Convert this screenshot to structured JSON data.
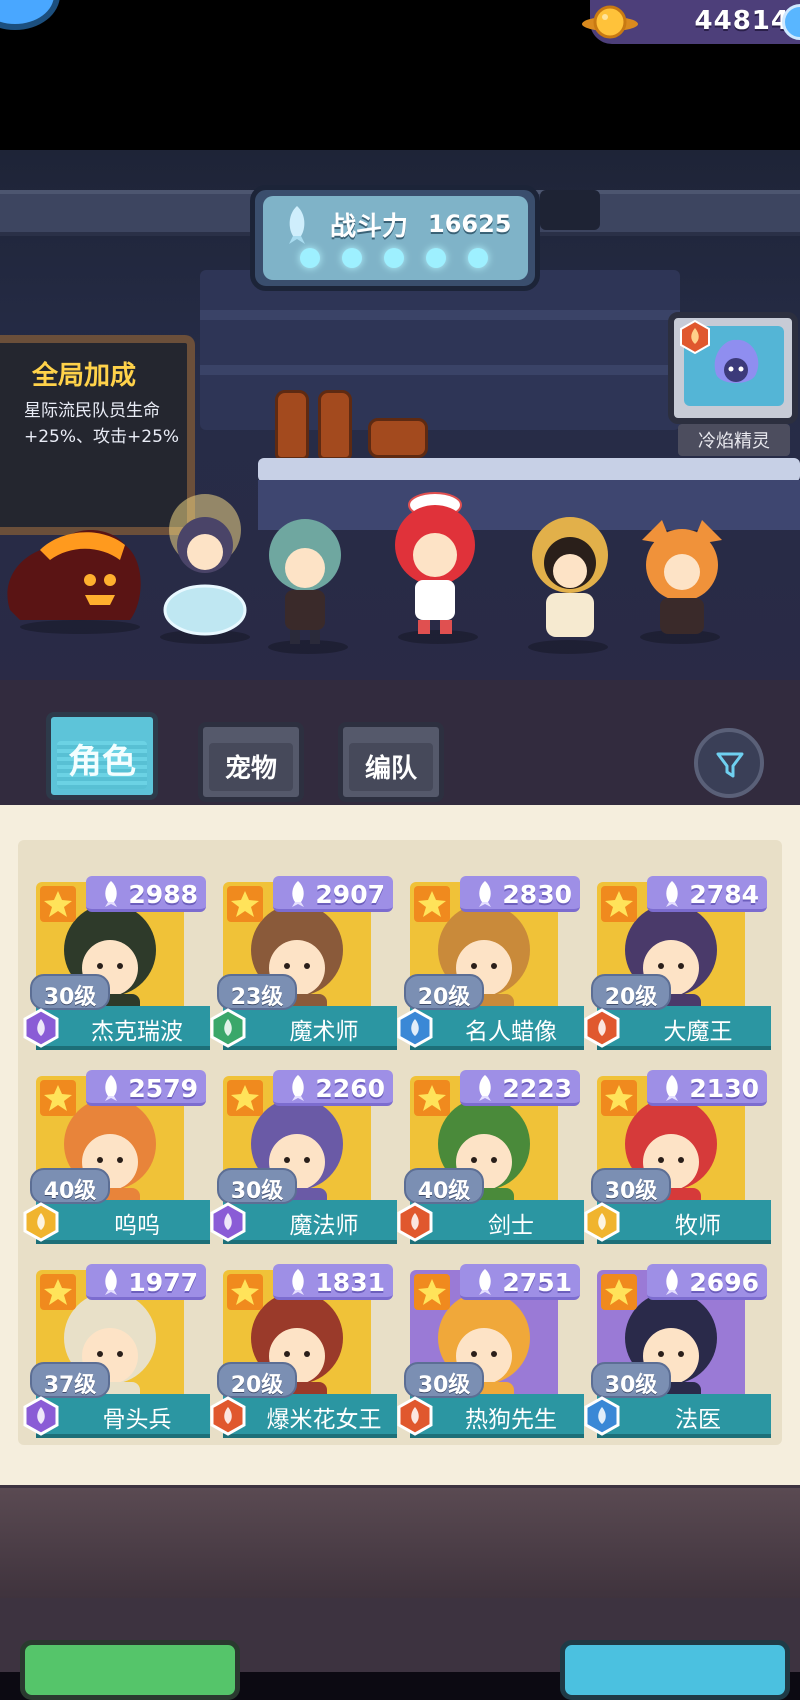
{
  "hud": {
    "currency_icon": "planet-coin-icon",
    "currency_value": "44814"
  },
  "power": {
    "label": "战斗力",
    "value": "16625",
    "dots": 5
  },
  "bonus_board": {
    "title": "全局加成",
    "text": "星际流民队员生命+25%、攻击+25%"
  },
  "tv": {
    "label": "冷焰精灵"
  },
  "tabs": [
    {
      "label": "角色",
      "active": true
    },
    {
      "label": "宠物",
      "active": false
    },
    {
      "label": "编队",
      "active": false
    }
  ],
  "filter_icon": "funnel-icon",
  "characters": [
    {
      "power": "2988",
      "level": "30级",
      "name": "杰克瑞波",
      "class_color": "#8a5cd6",
      "frame": "#f0c238",
      "art": "#2e3a2a"
    },
    {
      "power": "2907",
      "level": "23级",
      "name": "魔术师",
      "class_color": "#3aa76a",
      "frame": "#f0c238",
      "art": "#8a5a3a"
    },
    {
      "power": "2830",
      "level": "20级",
      "name": "名人蜡像",
      "class_color": "#3a88d6",
      "frame": "#f0c238",
      "art": "#c98a3a"
    },
    {
      "power": "2784",
      "level": "20级",
      "name": "大魔王",
      "class_color": "#e0582e",
      "frame": "#f0c238",
      "art": "#4a3a6a"
    },
    {
      "power": "2579",
      "level": "40级",
      "name": "呜呜",
      "class_color": "#f0b42e",
      "frame": "#f0c238",
      "art": "#e8843a"
    },
    {
      "power": "2260",
      "level": "30级",
      "name": "魔法师",
      "class_color": "#8a5cd6",
      "frame": "#f0c238",
      "art": "#6a5aa6"
    },
    {
      "power": "2223",
      "level": "40级",
      "name": "剑士",
      "class_color": "#e0582e",
      "frame": "#f0c238",
      "art": "#4a8a3a"
    },
    {
      "power": "2130",
      "level": "30级",
      "name": "牧师",
      "class_color": "#f0b42e",
      "frame": "#f0c238",
      "art": "#d63a3a"
    },
    {
      "power": "1977",
      "level": "37级",
      "name": "骨头兵",
      "class_color": "#8a5cd6",
      "frame": "#f0c238",
      "art": "#e8e0c8"
    },
    {
      "power": "1831",
      "level": "20级",
      "name": "爆米花女王",
      "class_color": "#e0582e",
      "frame": "#f0c238",
      "art": "#9a3a2a"
    },
    {
      "power": "2751",
      "level": "30级",
      "name": "热狗先生",
      "class_color": "#e0582e",
      "frame": "#9a7ad6",
      "art": "#f0a83a"
    },
    {
      "power": "2696",
      "level": "30级",
      "name": "法医",
      "class_color": "#3a88d6",
      "frame": "#9a7ad6",
      "art": "#2a2a4a"
    }
  ]
}
